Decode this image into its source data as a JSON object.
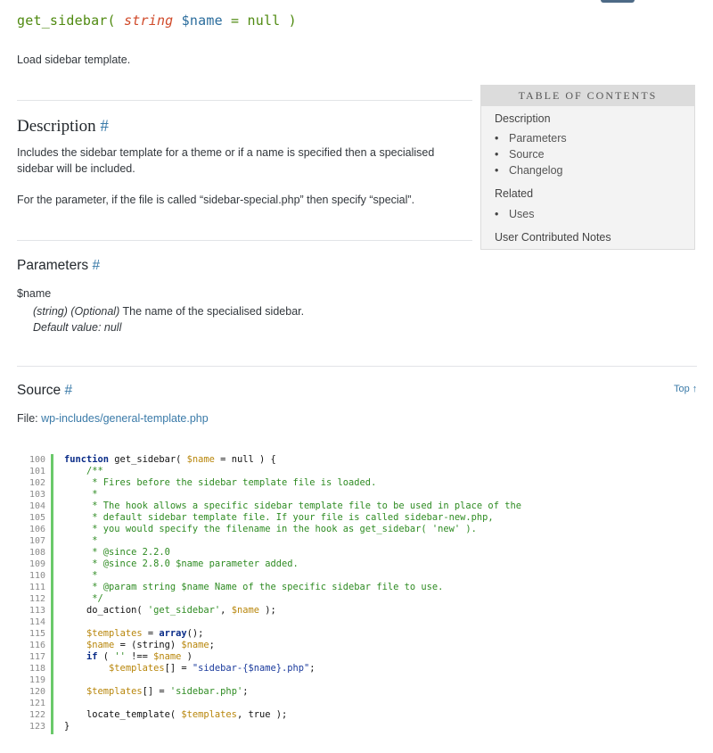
{
  "signature": {
    "fn": "get_sidebar(",
    "type": "string",
    "var": "$name",
    "rest": "= null )"
  },
  "summary": "Load sidebar template.",
  "description": {
    "title": "Description",
    "anchor": "#",
    "p1": "Includes the sidebar template for a theme or if a name is specified then a specialised sidebar will be included.",
    "p2": "For the parameter, if the file is called “sidebar-special.php” then specify “special”."
  },
  "toc": {
    "heading": "TABLE OF CONTENTS",
    "description": "Description",
    "description_items": [
      "Parameters",
      "Source",
      "Changelog"
    ],
    "related": "Related",
    "related_items": [
      "Uses"
    ],
    "notes": "User Contributed Notes"
  },
  "parameters": {
    "title": "Parameters",
    "anchor": "#",
    "name": "$name",
    "type_text": "(string) (Optional)",
    "desc": " The name of the specialised sidebar.",
    "default": "Default value: null"
  },
  "source": {
    "title": "Source",
    "anchor": "#",
    "top_link": "Top ↑",
    "file_label": "File: ",
    "file_path": "wp-includes/general-template.php"
  },
  "code": {
    "line_numbers": [
      "100",
      "101",
      "102",
      "103",
      "104",
      "105",
      "106",
      "107",
      "108",
      "109",
      "110",
      "111",
      "112",
      "113",
      "114",
      "115",
      "116",
      "117",
      "118",
      "119",
      "120",
      "121",
      "122",
      "123"
    ]
  }
}
